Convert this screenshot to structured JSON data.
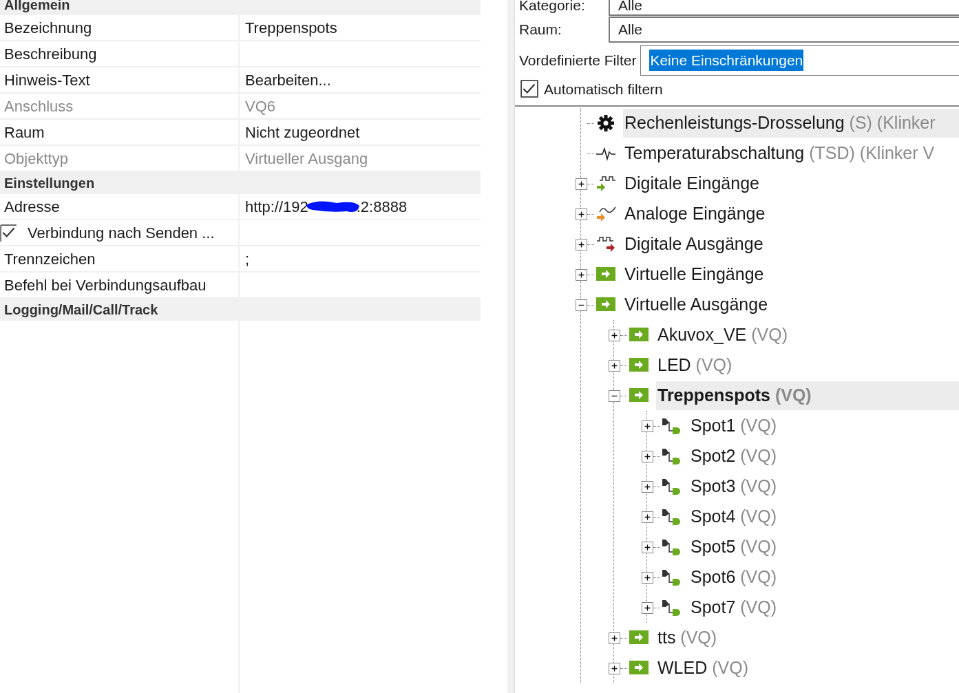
{
  "properties": [
    {
      "title": "Allgemein",
      "rows": [
        {
          "label": "Bezeichnung",
          "value": "Treppenspots",
          "disabled": false
        },
        {
          "label": "Beschreibung",
          "disabled": false
        },
        {
          "label": "Hinweis-Text",
          "value": "Bearbeiten...",
          "disabled": false
        },
        {
          "label": "Anschluss",
          "value": "VQ6",
          "disabled": true
        },
        {
          "label": "Raum",
          "value": "Nicht zugeordnet",
          "disabled": false
        },
        {
          "label": "Objekttyp",
          "value": "Virtueller Ausgang",
          "disabled": true
        }
      ]
    },
    {
      "title": "Einstellungen",
      "rows": [
        {
          "label": "Adresse",
          "value": "http://192",
          "redacted": true,
          "value_tail": ".2:8888",
          "disabled": false
        },
        {
          "label": "Verbindung nach Senden ...",
          "kind": "checkbox",
          "checked": true,
          "disabled": false
        },
        {
          "label": "Trennzeichen",
          "value": ";",
          "disabled": false
        },
        {
          "label": "Befehl bei Verbindungsaufbau",
          "disabled": false
        }
      ]
    },
    {
      "title": "Logging/Mail/Call/Track"
    }
  ],
  "filters": {
    "category": {
      "label": "Kategorie:",
      "value": "Alle"
    },
    "room": {
      "label": "Raum:",
      "value": "Alle"
    },
    "predefined": {
      "label": "Vordefinierte Filter",
      "value": "Keine Einschränkungen"
    },
    "auto_filter": {
      "label": "Automatisch filtern",
      "checked": true
    }
  },
  "tree": [
    {
      "kind": "gear",
      "label": "Rechenleistungs-Drosselung",
      "suffix": "(S) (Klinker",
      "selected": false,
      "hot": true
    },
    {
      "kind": "pulse",
      "label": "Temperaturabschaltung",
      "suffix": "(TSD) (Klinker V",
      "selected": false,
      "hot": false
    },
    {
      "kind": "digital-in",
      "label": "Digitale Eingänge",
      "expanded": false,
      "selected": false,
      "hot": false
    },
    {
      "kind": "analog-in",
      "label": "Analoge Eingänge",
      "expanded": false,
      "selected": false,
      "hot": false
    },
    {
      "kind": "digital-out",
      "label": "Digitale Ausgänge",
      "expanded": false,
      "selected": false,
      "hot": false
    },
    {
      "kind": "virtual",
      "label": "Virtuelle Eingänge",
      "expanded": false,
      "selected": false,
      "hot": false
    },
    {
      "kind": "virtual",
      "label": "Virtuelle Ausgänge",
      "expanded": true,
      "selected": false,
      "hot": false,
      "children": [
        {
          "kind": "virtual",
          "label": "Akuvox_VE",
          "suffix": "(VQ)",
          "expanded": false,
          "selected": false,
          "hot": false
        },
        {
          "kind": "virtual",
          "label": "LED",
          "suffix": "(VQ)",
          "expanded": false,
          "selected": false,
          "hot": false
        },
        {
          "kind": "virtual",
          "label": "Treppenspots",
          "suffix": "(VQ)",
          "expanded": true,
          "selected": true,
          "hot": false,
          "children": [
            {
              "kind": "spot",
              "label": "Spot1",
              "suffix": "(VQ)",
              "expanded": false,
              "selected": false,
              "hot": false
            },
            {
              "kind": "spot",
              "label": "Spot2",
              "suffix": "(VQ)",
              "expanded": false,
              "selected": false,
              "hot": false
            },
            {
              "kind": "spot",
              "label": "Spot3",
              "suffix": "(VQ)",
              "expanded": false,
              "selected": false,
              "hot": false
            },
            {
              "kind": "spot",
              "label": "Spot4",
              "suffix": "(VQ)",
              "expanded": false,
              "selected": false,
              "hot": false
            },
            {
              "kind": "spot",
              "label": "Spot5",
              "suffix": "(VQ)",
              "expanded": false,
              "selected": false,
              "hot": false
            },
            {
              "kind": "spot",
              "label": "Spot6",
              "suffix": "(VQ)",
              "expanded": false,
              "selected": false,
              "hot": false
            },
            {
              "kind": "spot",
              "label": "Spot7",
              "suffix": "(VQ)",
              "expanded": false,
              "selected": false,
              "hot": false
            }
          ]
        },
        {
          "kind": "virtual",
          "label": "tts",
          "suffix": "(VQ)",
          "expanded": false,
          "selected": false,
          "hot": false
        },
        {
          "kind": "virtual",
          "label": "WLED",
          "suffix": "(VQ)",
          "expanded": false,
          "selected": false,
          "hot": false
        }
      ]
    }
  ]
}
